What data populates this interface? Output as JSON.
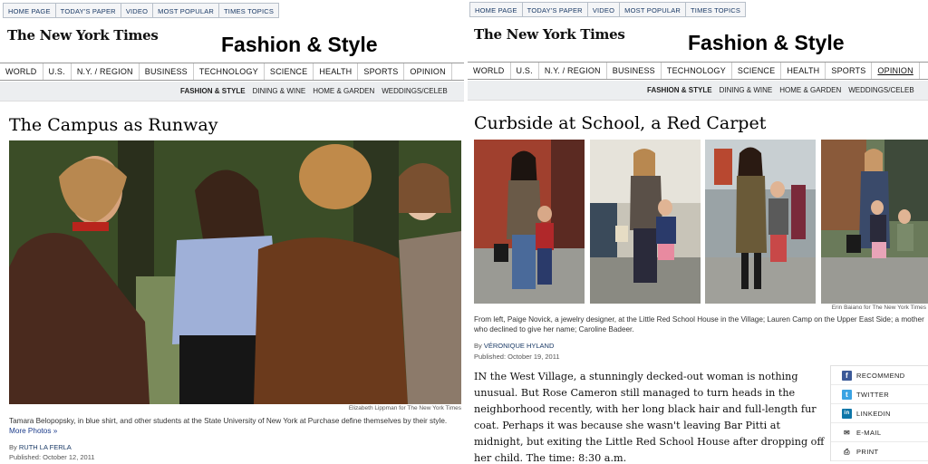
{
  "colors": {
    "nav_link": "#1a3a66",
    "link": "#1a3a8a",
    "subnav_bg": "#eceef0",
    "facebook": "#3b5998",
    "twitter": "#3aa3e3",
    "linkedin": "#0e76a8"
  },
  "left": {
    "topnav": [
      "HOME PAGE",
      "TODAY'S PAPER",
      "VIDEO",
      "MOST POPULAR",
      "TIMES TOPICS"
    ],
    "logo": "The New York Times",
    "section_title": "Fashion & Style",
    "mainnav": [
      "WORLD",
      "U.S.",
      "N.Y. / REGION",
      "BUSINESS",
      "TECHNOLOGY",
      "SCIENCE",
      "HEALTH",
      "SPORTS",
      "OPINION"
    ],
    "subnav": [
      "FASHION & STYLE",
      "DINING & WINE",
      "HOME & GARDEN",
      "WEDDINGS/CELEB"
    ],
    "headline": "The Campus as Runway",
    "photo_credit": "Elizabeth Lippman for The New York Times",
    "caption": "Tamara Belopopsky, in blue shirt, and other students at the State University of New York at Purchase define themselves by their style.",
    "more_photos": "More Photos »",
    "byline_prefix": "By",
    "byline_author": "RUTH LA FERLA",
    "published": "Published: October 12, 2011"
  },
  "right": {
    "topnav": [
      "HOME PAGE",
      "TODAY'S PAPER",
      "VIDEO",
      "MOST POPULAR",
      "TIMES TOPICS"
    ],
    "logo": "The New York Times",
    "section_title": "Fashion & Style",
    "mainnav": [
      "WORLD",
      "U.S.",
      "N.Y. / REGION",
      "BUSINESS",
      "TECHNOLOGY",
      "SCIENCE",
      "HEALTH",
      "SPORTS",
      "OPINION"
    ],
    "subnav": [
      "FASHION & STYLE",
      "DINING & WINE",
      "HOME & GARDEN",
      "WEDDINGS/CELEB"
    ],
    "headline": "Curbside at School, a Red Carpet",
    "photo_credit": "Erin Baiano for The New York Times",
    "caption": "From left, Paige Novick, a jewelry designer, at the Little Red School House in the Village; Lauren Camp on the Upper East Side; a mother who declined to give her name; Caroline Badeer.",
    "byline_prefix": "By",
    "byline_author": "VÉRONIQUE HYLAND",
    "published": "Published: October 19, 2011",
    "body": "IN the West Village, a stunningly decked-out woman is nothing unusual. But Rose Cameron still managed to turn heads in the neighborhood recently, with her long black hair and full-length fur coat. Perhaps it was because she wasn't leaving Bar Pitti at midnight, but exiting the Little Red School House after dropping off her child. The time: 8:30 a.m.",
    "share": [
      {
        "label": "RECOMMEND",
        "icon": "facebook-icon",
        "glyph": "f"
      },
      {
        "label": "TWITTER",
        "icon": "twitter-icon",
        "glyph": "t"
      },
      {
        "label": "LINKEDIN",
        "icon": "linkedin-icon",
        "glyph": "in"
      },
      {
        "label": "E-MAIL",
        "icon": "email-icon",
        "glyph": "✉"
      },
      {
        "label": "PRINT",
        "icon": "print-icon",
        "glyph": "⎙"
      }
    ]
  }
}
